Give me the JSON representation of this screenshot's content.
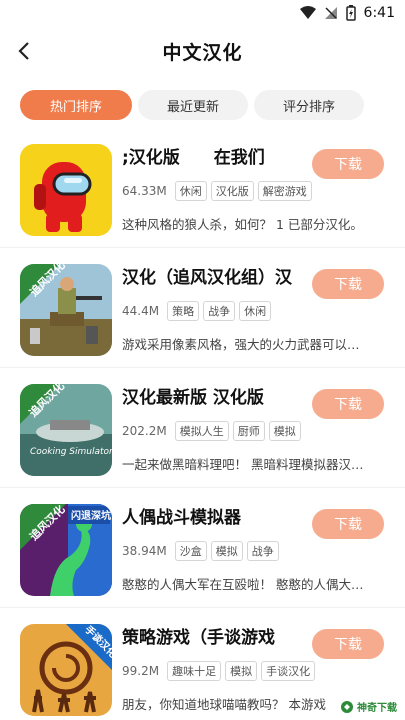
{
  "status": {
    "time": "6:41"
  },
  "header": {
    "title": "中文汉化"
  },
  "tabs": [
    {
      "label": "热门排序"
    },
    {
      "label": "最近更新"
    },
    {
      "label": "评分排序"
    }
  ],
  "items": [
    {
      "name": ";汉化版　　在我们",
      "size": "64.33M",
      "tags": [
        "休闲",
        "汉化版",
        "解密游戏"
      ],
      "desc": "这种风格的狼人杀，如何？ 1 已部分汉化。",
      "button": "下载"
    },
    {
      "name": "汉化（追风汉化组）汉",
      "size": "44.4M",
      "tags": [
        "策略",
        "战争",
        "休闲"
      ],
      "desc": "游戏采用像素风格，强大的火力武器可以…",
      "button": "下载"
    },
    {
      "name": "汉化最新版 汉化版",
      "size": "202.2M",
      "tags": [
        "模拟人生",
        "厨师",
        "模拟"
      ],
      "desc": "一起来做黑暗料理吧！ 黑暗料理模拟器汉…",
      "button": "下载"
    },
    {
      "name": "人偶战斗模拟器",
      "size": "38.94M",
      "tags": [
        "沙盒",
        "模拟",
        "战争"
      ],
      "desc": "憨憨的人偶大军在互殴啦！ 憨憨的人偶大…",
      "button": "下载"
    },
    {
      "name": "策略游戏（手谈游戏",
      "size": "99.2M",
      "tags": [
        "趣味十足",
        "模拟",
        "手谈汉化"
      ],
      "desc": "朋友，你知道地球喵喵教吗？ 本游戏",
      "button": "下载"
    }
  ],
  "icons": {
    "item2": "追风汉化",
    "item3": "追风汉化",
    "item3_game": "Cooking Simulator",
    "item4": "追风汉化",
    "item4_badge": "闪退深坑",
    "item5": "手谈汉化"
  },
  "watermark": "神奇下载"
}
